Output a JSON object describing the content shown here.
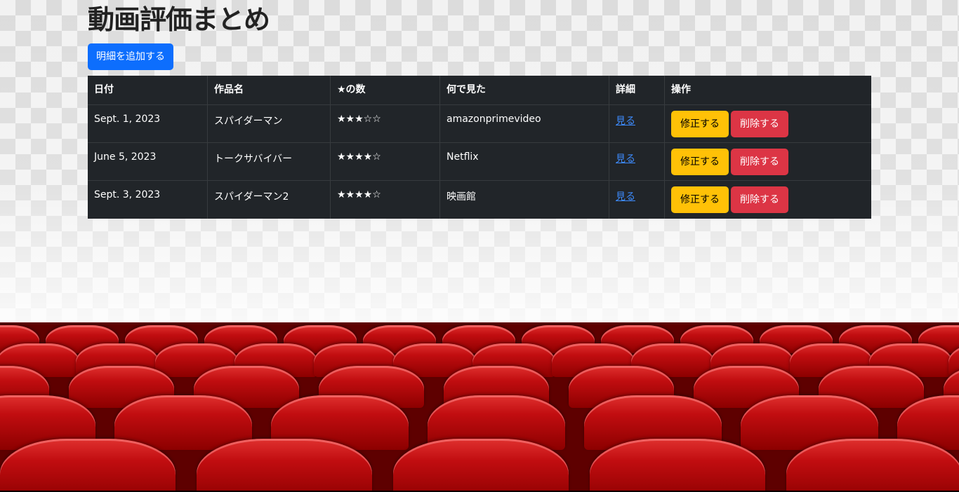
{
  "page": {
    "title": "動画評価まとめ",
    "add_button_label": "明細を追加する"
  },
  "table": {
    "headers": [
      "日付",
      "作品名",
      "★の数",
      "何で見た",
      "詳細",
      "操作"
    ],
    "rows": [
      {
        "date": "Sept. 1, 2023",
        "title": "スパイダーマン",
        "stars": "★★★☆☆",
        "where": "amazonprimevideo",
        "detail": "見る",
        "edit": "修正する",
        "delete": "削除する"
      },
      {
        "date": "June 5, 2023",
        "title": "トークサバイバー",
        "stars": "★★★★☆",
        "where": "Netflix",
        "detail": "見る",
        "edit": "修正する",
        "delete": "削除する"
      },
      {
        "date": "Sept. 3, 2023",
        "title": "スパイダーマン2",
        "stars": "★★★★☆",
        "where": "映画館",
        "detail": "見る",
        "edit": "修正する",
        "delete": "削除する"
      }
    ]
  },
  "colors": {
    "primary": "#0d6efd",
    "warning": "#ffc107",
    "danger": "#dc3545",
    "table_dark": "#212529",
    "seat_red": "#c10d10"
  }
}
